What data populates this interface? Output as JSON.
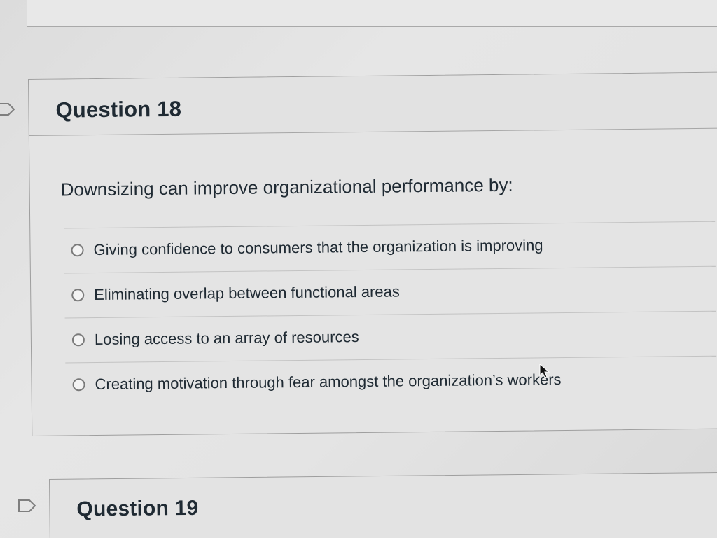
{
  "current_question": {
    "title": "Question 18",
    "prompt": "Downsizing can improve organizational performance by:",
    "answers": [
      {
        "label": "Giving confidence to consumers that the organization is improving",
        "selected": false
      },
      {
        "label": "Eliminating overlap between functional areas",
        "selected": false
      },
      {
        "label": "Losing access to an array of resources",
        "selected": false
      },
      {
        "label": "Creating motivation through fear amongst the organization’s workers",
        "selected": false
      }
    ]
  },
  "next_question": {
    "title": "Question 19"
  },
  "icons": {
    "flag": "flag-outline-icon",
    "radio": "radio-unselected-icon",
    "cursor": "mouse-pointer-icon"
  }
}
